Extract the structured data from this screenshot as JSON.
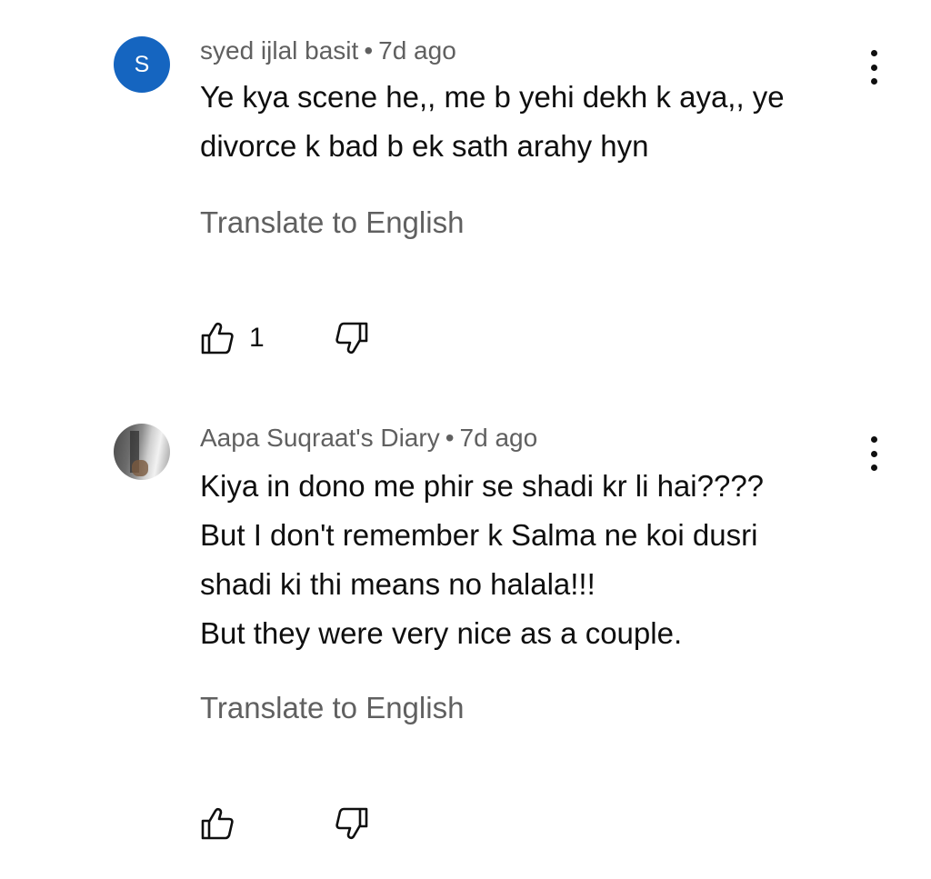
{
  "comments": [
    {
      "author": "syed ijlal basit",
      "separator": "•",
      "time": "7d ago",
      "avatar_letter": "S",
      "avatar_color": "#1565c0",
      "lines": [
        "Ye kya scene he,,  me b yehi dekh k aya,,  ye",
        "divorce k bad b ek sath arahy hyn"
      ],
      "translate_label": "Translate to English",
      "like_count": "1",
      "like_icon": "thumbs-up-icon",
      "dislike_icon": "thumbs-down-icon",
      "menu_icon": "more-vert-icon"
    },
    {
      "author": "Aapa Suqraat's Diary",
      "separator": "•",
      "time": "7d ago",
      "avatar_letter": "",
      "lines": [
        "Kiya in dono me phir se shadi kr li hai????",
        "But I don't remember k Salma ne koi dusri",
        "shadi ki thi means no halala!!!",
        "But they were very nice as a couple."
      ],
      "translate_label": "Translate to English",
      "like_count": "",
      "like_icon": "thumbs-up-icon",
      "dislike_icon": "thumbs-down-icon",
      "menu_icon": "more-vert-icon"
    }
  ],
  "colors": {
    "text_primary": "#0f0f0f",
    "text_secondary": "#606060",
    "background": "#ffffff"
  }
}
